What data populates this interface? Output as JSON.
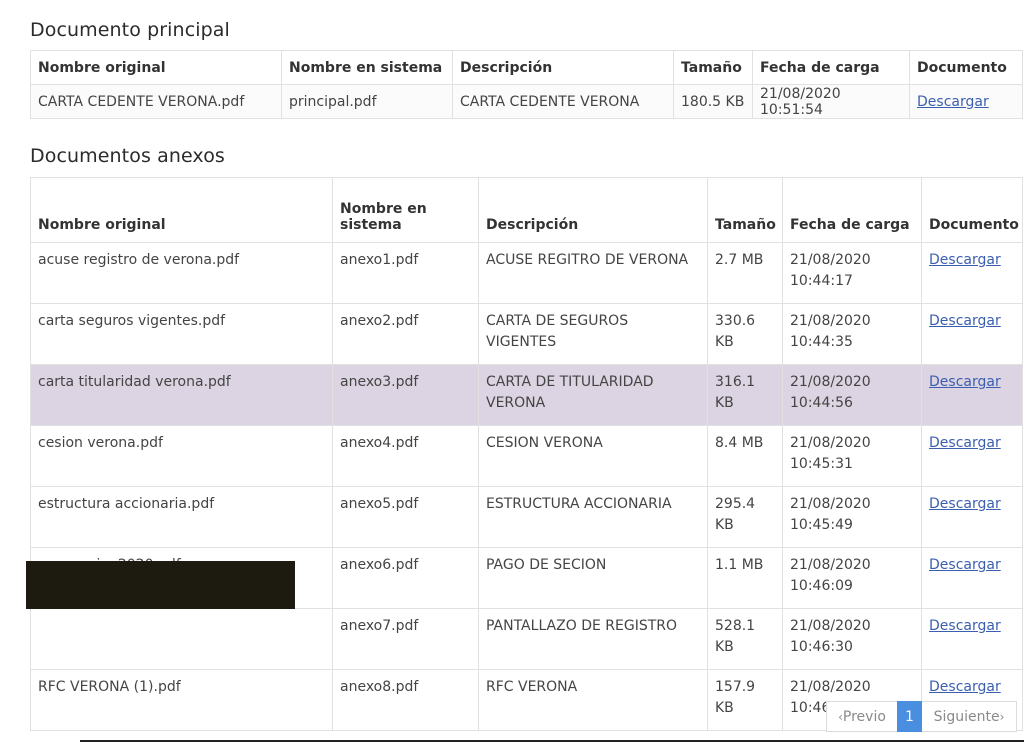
{
  "main": {
    "title": "Documento principal",
    "headers": [
      "Nombre original",
      "Nombre en sistema",
      "Descripción",
      "Tamaño",
      "Fecha de carga",
      "Documento"
    ],
    "row": {
      "original": "CARTA CEDENTE VERONA.pdf",
      "system": "principal.pdf",
      "description": "CARTA CEDENTE VERONA",
      "size": "180.5 KB",
      "date": "21/08/2020 10:51:54",
      "link": "Descargar"
    }
  },
  "annex": {
    "title": "Documentos anexos",
    "headers": [
      "Nombre original",
      "Nombre en sistema",
      "Descripción",
      "Tamaño",
      "Fecha de carga",
      "Documento"
    ],
    "rows": [
      {
        "original": "acuse registro de verona.pdf",
        "system": "anexo1.pdf",
        "description": "ACUSE REGITRO DE VERONA",
        "size": "2.7 MB",
        "date": "21/08/2020 10:44:17",
        "link": "Descargar"
      },
      {
        "original": "carta seguros vigentes.pdf",
        "system": "anexo2.pdf",
        "description": "CARTA DE SEGUROS VIGENTES",
        "size": "330.6 KB",
        "date": "21/08/2020 10:44:35",
        "link": "Descargar"
      },
      {
        "original": "carta titularidad verona.pdf",
        "system": "anexo3.pdf",
        "description": "CARTA DE TITULARIDAD VERONA",
        "size": "316.1 KB",
        "date": "21/08/2020 10:44:56",
        "link": "Descargar"
      },
      {
        "original": "cesion verona.pdf",
        "system": "anexo4.pdf",
        "description": "CESION VERONA",
        "size": "8.4 MB",
        "date": "21/08/2020 10:45:31",
        "link": "Descargar"
      },
      {
        "original": "estructura accionaria.pdf",
        "system": "anexo5.pdf",
        "description": "ESTRUCTURA ACCIONARIA",
        "size": "295.4 KB",
        "date": "21/08/2020 10:45:49",
        "link": "Descargar"
      },
      {
        "original": "pagocesion2020.pdf",
        "system": "anexo6.pdf",
        "description": "PAGO DE SECION",
        "size": "1.1 MB",
        "date": "21/08/2020 10:46:09",
        "link": "Descargar"
      },
      {
        "original": "",
        "system": "anexo7.pdf",
        "description": "PANTALLAZO DE REGISTRO",
        "size": "528.1 KB",
        "date": "21/08/2020 10:46:30",
        "link": "Descargar"
      },
      {
        "original": "RFC VERONA (1).pdf",
        "system": "anexo8.pdf",
        "description": "RFC VERONA",
        "size": "157.9 KB",
        "date": "21/08/2020 10:46:46",
        "link": "Descargar"
      }
    ],
    "highlighted_row": 2
  },
  "pagination": {
    "prev_label": "Previo",
    "current_page": "1",
    "next_label": "Siguiente",
    "prev_icon": "chevron-left-icon",
    "next_icon": "chevron-right-icon"
  },
  "colors": {
    "highlight_row": "#dcd4e2",
    "link": "#3b5fb0",
    "active_page": "#4a8ee0"
  }
}
